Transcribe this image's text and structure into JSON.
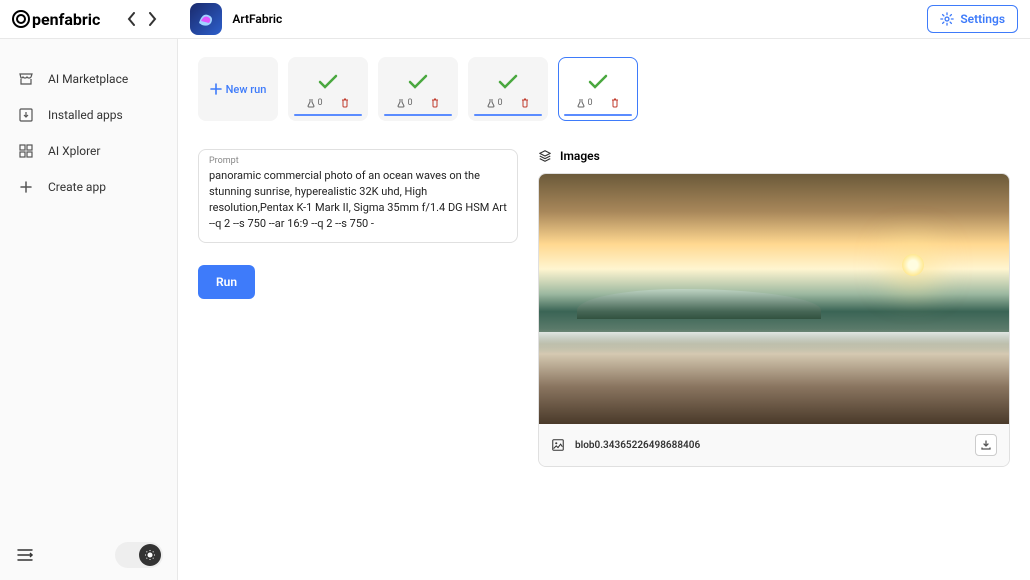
{
  "header": {
    "logo_text": "penfabric",
    "app_name": "ArtFabric",
    "settings_label": "Settings"
  },
  "sidebar": {
    "items": [
      {
        "label": "AI Marketplace",
        "icon": "store"
      },
      {
        "label": "Installed apps",
        "icon": "download-box"
      },
      {
        "label": "AI Xplorer",
        "icon": "grid"
      },
      {
        "label": "Create app",
        "icon": "plus"
      }
    ]
  },
  "runs": {
    "new_label": "New run",
    "cards": [
      {
        "status": "success",
        "beaker": "0",
        "trash": true
      },
      {
        "status": "success",
        "beaker": "0",
        "trash": true
      },
      {
        "status": "success",
        "beaker": "0",
        "trash": true
      },
      {
        "status": "success",
        "beaker": "0",
        "trash": true,
        "selected": true
      }
    ]
  },
  "prompt": {
    "label": "Prompt",
    "text": "panoramic commercial photo of an ocean waves on the stunning sunrise, hyperealistic 32K uhd, High resolution,Pentax K-1 Mark II, Sigma 35mm f/1.4 DG HSM Art --q 2 --s 750 --ar 16:9 --q 2 --s 750 -"
  },
  "run_button": "Run",
  "images": {
    "header": "Images",
    "filename": "blob0.34365226498688406"
  }
}
